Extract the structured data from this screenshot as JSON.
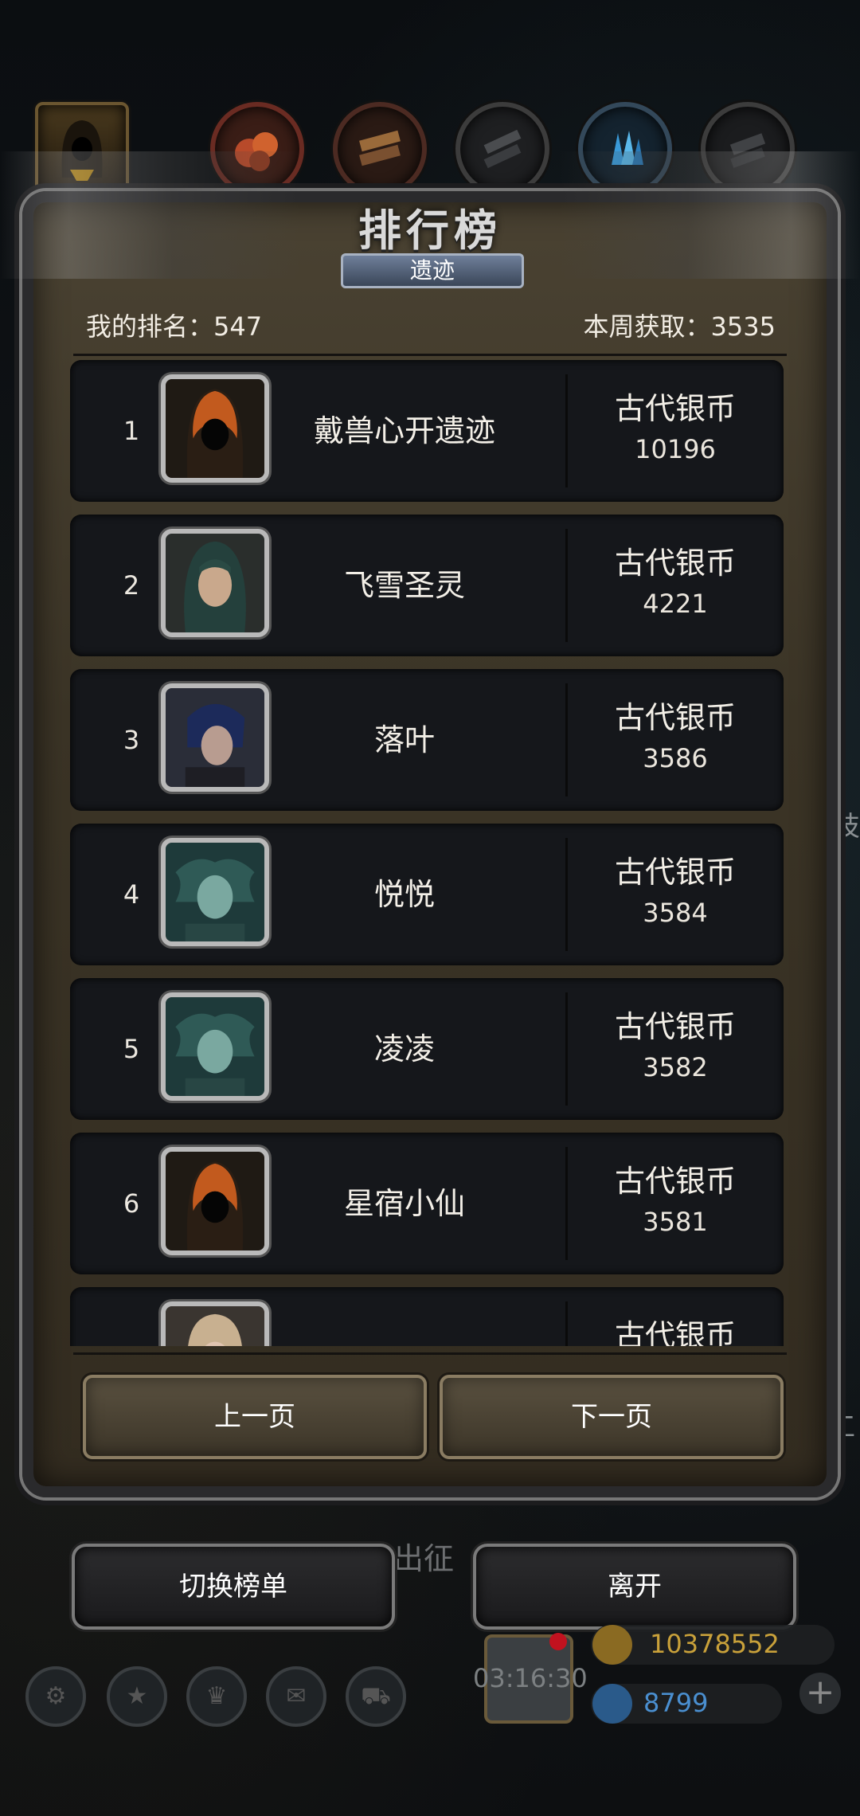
{
  "leaderboard": {
    "title": "排行榜",
    "subtitle": "遗迹",
    "my_rank": "我的排名：547",
    "week_earned": "本周获取：3535"
  },
  "rows": [
    {
      "rank": "1",
      "name": "戴兽心开遗迹",
      "reward_name": "古代银币",
      "reward_value": "10196"
    },
    {
      "rank": "2",
      "name": "飞雪圣灵",
      "reward_name": "古代银币",
      "reward_value": "4221"
    },
    {
      "rank": "3",
      "name": "落叶",
      "reward_name": "古代银币",
      "reward_value": "3586"
    },
    {
      "rank": "4",
      "name": "悦悦",
      "reward_name": "古代银币",
      "reward_value": "3584"
    },
    {
      "rank": "5",
      "name": "凌凌",
      "reward_name": "古代银币",
      "reward_value": "3582"
    },
    {
      "rank": "6",
      "name": "星宿小仙",
      "reward_name": "古代银币",
      "reward_value": "3581"
    },
    {
      "rank": "",
      "name": "",
      "reward_name": "古代银币",
      "reward_value": ""
    }
  ],
  "pager": {
    "prev": "上一页",
    "next": "下一页"
  },
  "actions": {
    "switch": "切换榜单",
    "leave": "离开"
  },
  "background": {
    "chuzheng": "出征",
    "side_text_right_1": "技",
    "side_text_right_2": "工"
  },
  "hud": {
    "timer": "03:16:30",
    "gold": "10378552",
    "gems": "8799",
    "gold_color": "#c9a13a",
    "gem_color": "#4a8fd0"
  }
}
